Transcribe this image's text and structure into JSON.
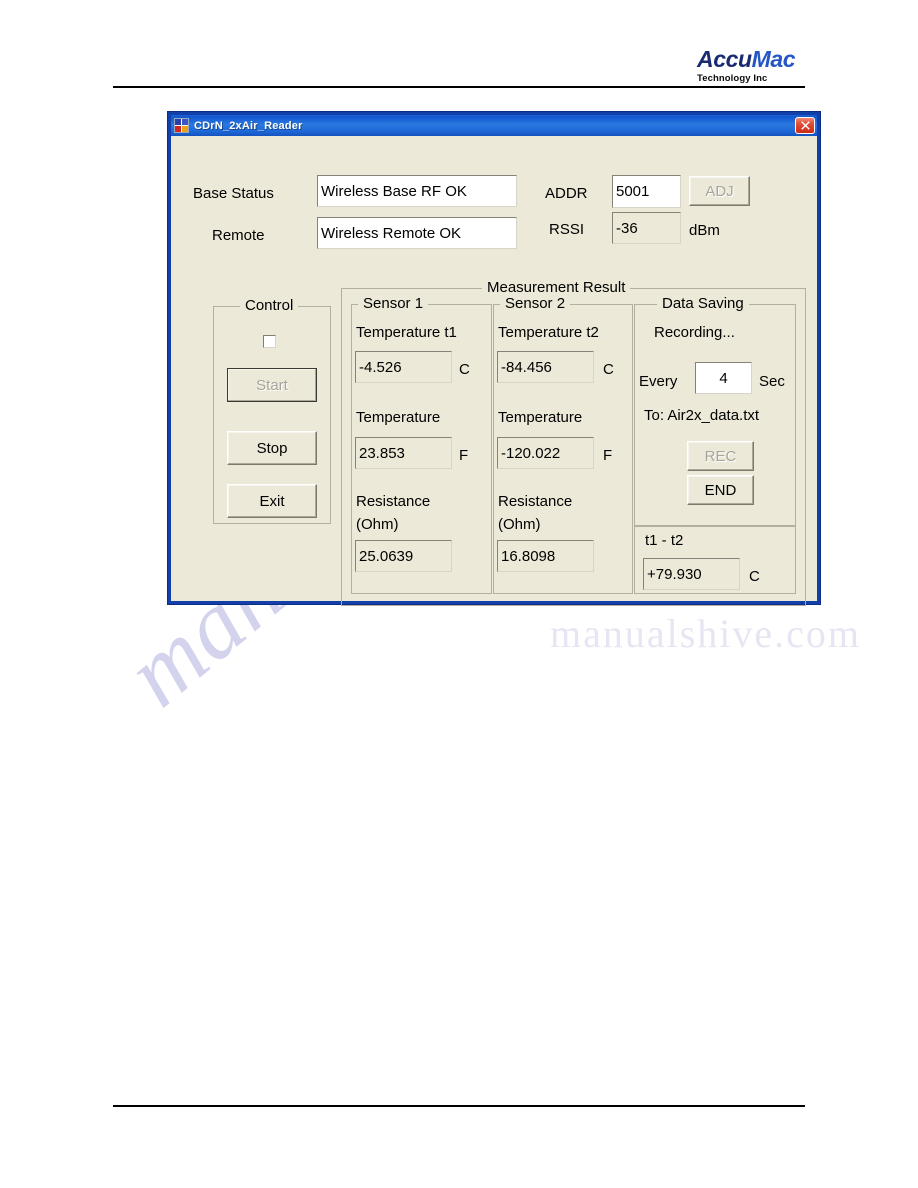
{
  "document": {
    "brand": {
      "name_part1": "Accu",
      "name_part2": "Mac",
      "tagline": "Technology Inc"
    },
    "watermark": {
      "text": "manualshive.com",
      "secondary": "manualshive.com"
    }
  },
  "window": {
    "title": "CDrN_2xAir_Reader",
    "icon": "app-icon",
    "close_label": "Close"
  },
  "status": {
    "base_label": "Base Status",
    "base_value": "Wireless Base RF OK",
    "remote_label": "Remote",
    "remote_value": "Wireless Remote OK"
  },
  "radio": {
    "addr_label": "ADDR",
    "addr_value": "5001",
    "adj_label": "ADJ",
    "adj_enabled": false,
    "rssi_label": "RSSI",
    "rssi_value": "-36",
    "rssi_unit": "dBm"
  },
  "control": {
    "title": "Control",
    "checkbox_checked": false,
    "start_label": "Start",
    "start_enabled": false,
    "stop_label": "Stop",
    "exit_label": "Exit"
  },
  "measurement": {
    "title": "Measurement Result",
    "sensor1": {
      "title": "Sensor 1",
      "temp_label": "Temperature t1",
      "temp_value": "-4.526",
      "temp_unit": "C",
      "temp_f_label": "Temperature",
      "temp_f_value": "23.853",
      "temp_f_unit": "F",
      "resistance_label": "Resistance",
      "resistance_label2": "(Ohm)",
      "resistance_value": "25.0639"
    },
    "sensor2": {
      "title": "Sensor 2",
      "temp_label": "Temperature t2",
      "temp_value": "-84.456",
      "temp_unit": "C",
      "temp_f_label": "Temperature",
      "temp_f_value": "-120.022",
      "temp_f_unit": "F",
      "resistance_label": "Resistance",
      "resistance_label2": "(Ohm)",
      "resistance_value": "16.8098"
    },
    "data_saving": {
      "title": "Data Saving",
      "status": "Recording...",
      "every_label": "Every",
      "interval_value": "4",
      "sec_label": "Sec",
      "file_label": "To: Air2x_data.txt",
      "rec_label": "REC",
      "rec_enabled": false,
      "end_label": "END"
    },
    "difference": {
      "label": "t1 - t2",
      "value": "+79.930",
      "unit": "C"
    }
  },
  "colors": {
    "title_bar": "#1d66d6",
    "dialog_face": "#ece9d8",
    "window_border": "#1340a8",
    "close_red": "#cb2a16",
    "brand_navy": "#1a2a72",
    "brand_blue": "#2457c5",
    "watermark": "#b9b9e4"
  }
}
